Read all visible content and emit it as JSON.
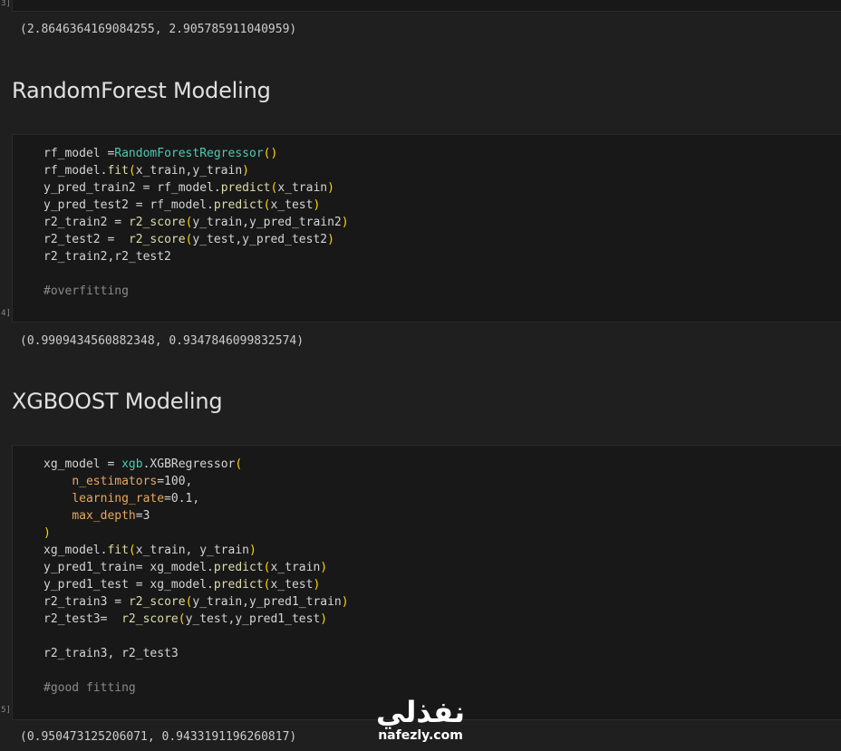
{
  "cells": {
    "prev": {
      "exec_label": "3]",
      "output": "(2.8646364169084255, 2.905785911040959)"
    },
    "rf": {
      "heading": "RandomForest Modeling",
      "exec_label": "4]",
      "output": "(0.9909434560882348, 0.9347846099832574)"
    },
    "xg": {
      "heading": "XGBOOST Modeling",
      "exec_label": "5]",
      "output": "(0.950473125206071, 0.9433191196260817)"
    }
  },
  "tok": {
    "rf_model": "rf_model",
    "eq": " =",
    "eq_sp": " = ",
    "eq2": "= ",
    "eq2sp": "=  ",
    "RandomForestRegressor": "RandomForestRegressor",
    "lp": "(",
    "rp": ")",
    "fit": "fit",
    "dot": ".",
    "x_train_y_train": "x_train,y_train",
    "y_pred_train2": "y_pred_train2",
    "predict": "predict",
    "x_train": "x_train",
    "x_test": "x_test",
    "y_pred_test2": "y_pred_test2",
    "r2_train2": "r2_train2",
    "r2_score": "r2_score",
    "y_train_y_pred_train2": "y_train,y_pred_train2",
    "r2_test2": "r2_test2",
    "y_test_y_pred_test2": "y_test,y_pred_test2",
    "r2_train2_r2_test2": "r2_train2,r2_test2",
    "c_overfitting": "#overfitting",
    "xg_model": "xg_model",
    "xgb": "xgb",
    "XGBRegressor": "XGBRegressor",
    "n_estimators": "n_estimators",
    "v100": "=100,",
    "learning_rate": "learning_rate",
    "v01": "=0.1,",
    "max_depth": "max_depth",
    "v3": "=3",
    "x_train_sp_y_train": "x_train, y_train",
    "y_pred1_train": "y_pred1_train",
    "eqnsp": "= ",
    "y_pred1_test": "y_pred1_test",
    "r2_train3": "r2_train3",
    "y_train_y_pred1_train": "y_train,y_pred1_train",
    "r2_test3": "r2_test3",
    "y_test_y_pred1_test": "y_test,y_pred1_test",
    "r2_train3_r2_test3": "r2_train3, r2_test3",
    "c_good": "#good fitting",
    "indent": "    "
  },
  "watermark": {
    "arabic": "نفذلي",
    "latin": "nafezly.com"
  },
  "colors": {
    "background": "#1f1f1f",
    "cell_background": "#181818",
    "function": "#dcdcaa",
    "class": "#4ec9b0",
    "keyword_arg": "#e8a85c",
    "bracket": "#ffd700",
    "comment": "#8a8a8a"
  }
}
